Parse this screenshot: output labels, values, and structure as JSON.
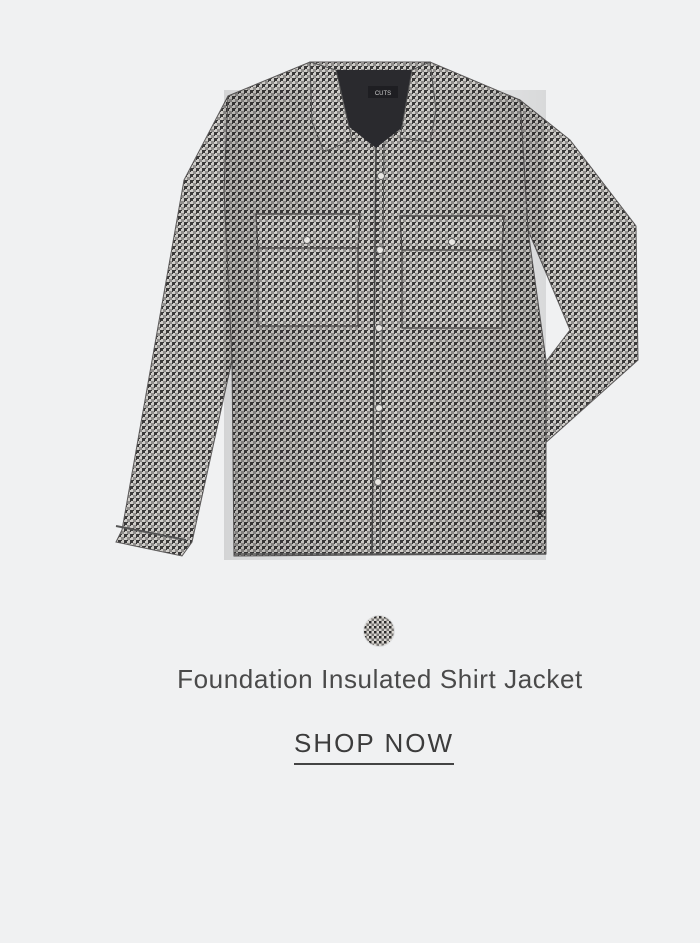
{
  "product": {
    "name": "Foundation Insulated Shirt Jacket",
    "cta_label": "SHOP NOW",
    "brand_tag": "CUTS",
    "image_icon": "houndstooth-shirt-jacket",
    "swatch": {
      "icon": "houndstooth-swatch",
      "colors": [
        "#d9d6d0",
        "#2b2a2a"
      ]
    }
  },
  "colors": {
    "background": "#f0f1f2",
    "text": "#4a4a4a",
    "fabric_light": "#c9c7c4",
    "fabric_dark": "#5c5a5a"
  }
}
